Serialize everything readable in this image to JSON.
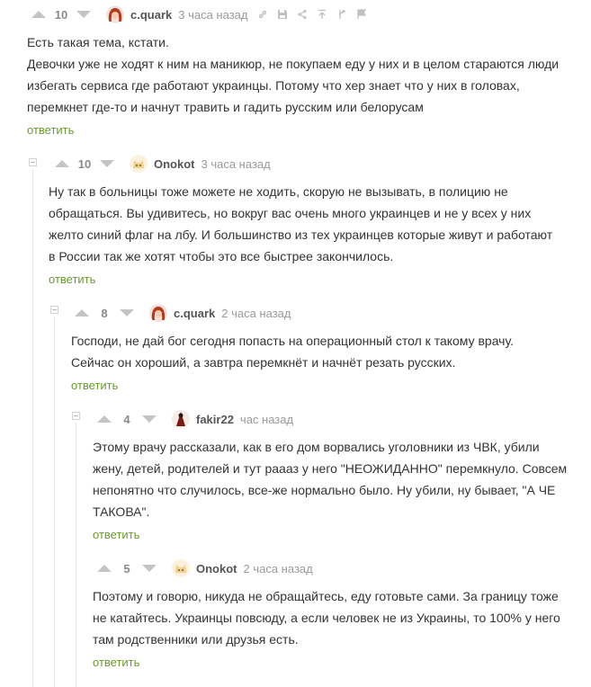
{
  "comments": [
    {
      "rating": "10",
      "author": "c.quark",
      "time": "3 часа назад",
      "lines": [
        "Есть такая тема, кстати.",
        "Девочки уже не ходят к ним на маникюр, не покупаем еду у них и в целом стараются люди",
        "избегать сервиса где работают украинцы. Потому что хер знает что у них в головах,",
        "перемкнет где-то и начнут травить и гадить русским или белорусам"
      ],
      "reply": "ответить",
      "avatar_icon": "redhead-avatar"
    },
    {
      "rating": "10",
      "author": "Onokot",
      "time": "3 часа назад",
      "lines": [
        "Ну так в больницы тоже можете не ходить, скорую не вызывать, в полицию не",
        "обращаться. Вы удивитесь, но вокруг вас очень много украинцев и не у всех у них",
        "желто синий флаг на лбу. И большинство из тех украинцев которые живут и работают",
        "в России так же хотят чтобы это все быстрее закончилось."
      ],
      "reply": "ответить",
      "avatar_icon": "cat-avatar"
    },
    {
      "rating": "8",
      "author": "c.quark",
      "time": "2 часа назад",
      "lines": [
        "Господи, не дай бог сегодня попасть на операционный стол к такому врачу.",
        "Сейчас он хороший, а завтра перемкнёт и начнёт резать русских."
      ],
      "reply": "ответить",
      "avatar_icon": "redhead-avatar"
    },
    {
      "rating": "4",
      "author": "fakir22",
      "time": "час назад",
      "lines": [
        "Этому врачу рассказали, как в его дом ворвались уголовники из ЧВК, убили",
        "жену, детей, родителей и тут рааaз у него \"НЕОЖИДАННО\" перемкнуло. Совсем",
        "непонятно что случилось, все-же нормально было. Ну убили, ну бывает, \"А ЧЕ",
        "ТАКОВА\"."
      ],
      "reply": "ответить",
      "avatar_icon": "robe-avatar"
    },
    {
      "rating": "5",
      "author": "Onokot",
      "time": "2 часа назад",
      "lines": [
        "Поэтому и говорю, никуда не обращайтесь, еду готовьте сами. За границу тоже",
        "не катайтесь. Украинцы повсюду, а если человек не из Украины, то 100% у него",
        "там родственники или друзья есть."
      ],
      "reply": "ответить",
      "avatar_icon": "cat-avatar"
    }
  ],
  "colors": {
    "reply_link": "#6b9a2e",
    "arrow": "#c4c4c4",
    "thread_line": "#e6e6e6"
  }
}
